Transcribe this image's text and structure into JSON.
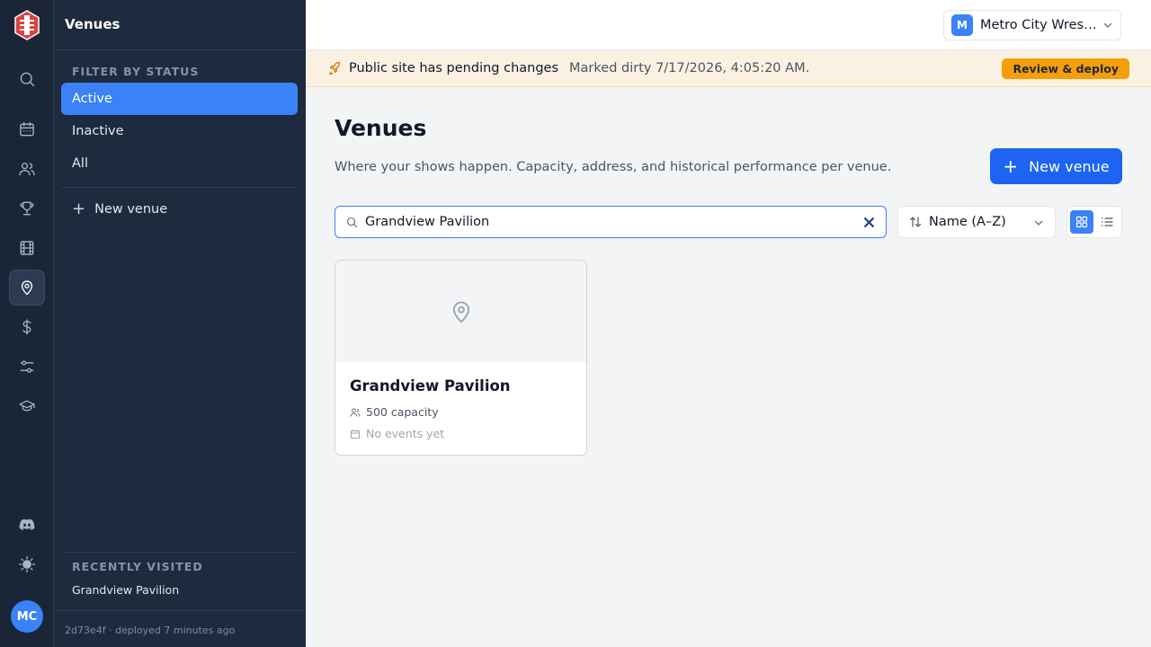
{
  "app": {
    "rail_items": [
      {
        "icon": "search-icon"
      },
      {
        "icon": "calendar-icon"
      },
      {
        "icon": "users-icon"
      },
      {
        "icon": "trophy-icon"
      },
      {
        "icon": "film-icon"
      },
      {
        "icon": "map-pin-icon",
        "active": true
      },
      {
        "icon": "dollar-icon"
      },
      {
        "icon": "sliders-icon"
      },
      {
        "icon": "graduation-cap-icon"
      }
    ],
    "rail_bottom": [
      {
        "icon": "discord-icon"
      },
      {
        "icon": "sun-icon"
      }
    ],
    "user_initials": "MC"
  },
  "sidebar": {
    "title": "Venues",
    "filter_heading": "FILTER BY STATUS",
    "filters": [
      {
        "label": "Active",
        "active": true
      },
      {
        "label": "Inactive",
        "active": false
      },
      {
        "label": "All",
        "active": false
      }
    ],
    "new_label": "New venue",
    "recent_heading": "RECENTLY VISITED",
    "recent_items": [
      "Grandview Pavilion"
    ],
    "footer": "2d73e4f · deployed 7 minutes ago"
  },
  "topbar": {
    "org_initial": "M",
    "org_name": "Metro City Wrestling"
  },
  "banner": {
    "title": "Public site has pending changes",
    "meta": "Marked dirty 7/17/2026, 4:05:20 AM.",
    "action": "Review & deploy"
  },
  "main": {
    "title": "Venues",
    "subtitle": "Where your shows happen. Capacity, address, and historical performance per venue.",
    "new_button": "New venue",
    "search_value": "Grandview Pavilion",
    "sort_label": "Name (A–Z)",
    "view_mode": "grid",
    "venues": [
      {
        "name": "Grandview Pavilion",
        "capacity": "500 capacity",
        "events": "No events yet"
      }
    ]
  },
  "colors": {
    "accent": "#3b82f6",
    "primary_button": "#1d64f2",
    "warning": "#f59e0b",
    "sidebar_bg": "#1e2a3d",
    "rail_bg": "#1a2638"
  }
}
